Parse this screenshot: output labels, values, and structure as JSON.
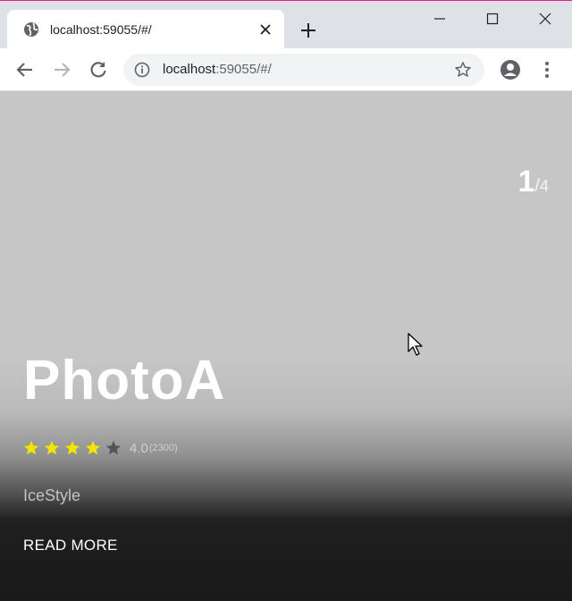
{
  "browser": {
    "tab_title": "localhost:59055/#/",
    "url_host": "localhost",
    "url_rest": ":59055/#/",
    "icons": {
      "favicon": "globe-icon",
      "tab_close": "close-icon",
      "new_tab": "plus-icon",
      "minimize": "minimize-icon",
      "maximize": "maximize-icon",
      "close": "close-icon",
      "back": "arrow-left-icon",
      "forward": "arrow-right-icon",
      "reload": "reload-icon",
      "site_info": "info-icon",
      "bookmark": "star-outline-icon",
      "profile": "account-icon",
      "menu": "kebab-menu-icon"
    }
  },
  "slide": {
    "current": "1",
    "separator": "/",
    "total": "4",
    "title": "PhotoA",
    "rating": {
      "value": "4.0",
      "count": "(2300)",
      "stars_filled": 4,
      "stars_total": 5,
      "filled_color": "#f5e400",
      "empty_color": "#555555"
    },
    "subtitle": "IceStyle",
    "cta_label": "READ MORE"
  },
  "colors": {
    "tabstrip": "#dee1e6",
    "accent_top": "#e91e8c",
    "slide_bg_top": "#c6c6c6",
    "slide_bg_bottom": "#1a1a1a"
  }
}
